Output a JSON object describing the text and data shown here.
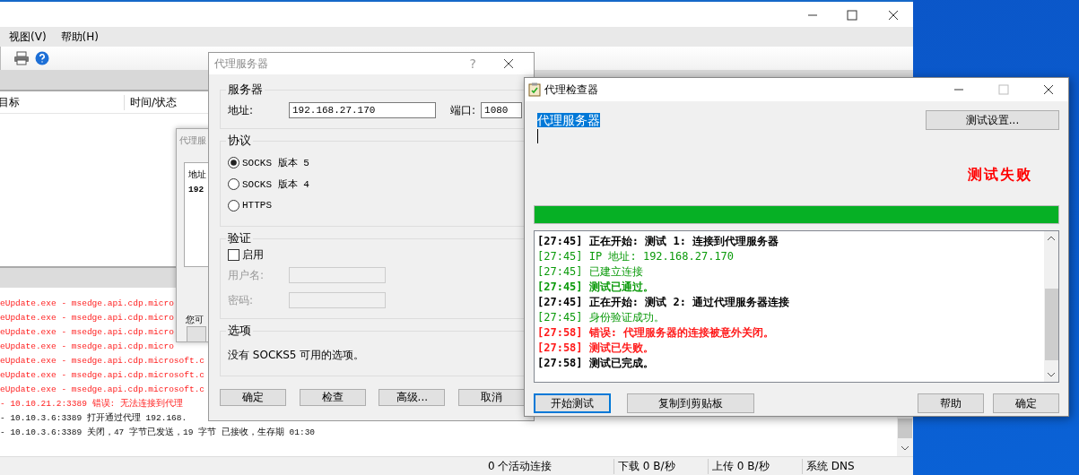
{
  "main_window": {
    "menu": [
      "视图(V)",
      "帮助(H)"
    ],
    "columns": [
      "目标",
      "时间/状态"
    ],
    "log": [
      {
        "text": "eUpdate.exe - msedge.api.cdp.micro",
        "kind": "error"
      },
      {
        "text": "eUpdate.exe - msedge.api.cdp.micro",
        "kind": "error"
      },
      {
        "text": "eUpdate.exe - msedge.api.cdp.micro",
        "kind": "error"
      },
      {
        "text": "eUpdate.exe - msedge.api.cdp.micro",
        "kind": "error"
      },
      {
        "text": "eUpdate.exe - msedge.api.cdp.microsoft.c",
        "kind": "error"
      },
      {
        "text": "eUpdate.exe - msedge.api.cdp.microsoft.c",
        "kind": "error"
      },
      {
        "text": "eUpdate.exe - msedge.api.cdp.microsoft.c",
        "kind": "error"
      },
      {
        "text": "- 10.10.21.2:3389 错误: 无法连接到代理",
        "kind": "error"
      },
      {
        "text": "- 10.10.3.6:3389 打开通过代理 192.168.",
        "kind": "info"
      },
      {
        "text": "- 10.10.3.6:3389 关闭，47 字节已发送，19 字节 已接收，生存期 01:30",
        "kind": "info"
      }
    ],
    "status_bar": [
      "0 个活动连接",
      "下载 0 B/秒",
      "上传 0 B/秒",
      "系统 DNS"
    ]
  },
  "background_dialog": {
    "title": "代理服",
    "label": "地址",
    "value": "192",
    "note": "您可"
  },
  "proxy_dialog": {
    "title": "代理服务器",
    "help": "?",
    "server_group": "服务器",
    "address_label": "地址:",
    "address": "192.168.27.170",
    "port_label": "端口:",
    "port": "1080",
    "protocol_group": "协议",
    "protocols": [
      {
        "label": "SOCKS 版本 5",
        "selected": true
      },
      {
        "label": "SOCKS 版本 4",
        "selected": false
      },
      {
        "label": "HTTPS",
        "selected": false
      }
    ],
    "auth_group": "验证",
    "auth_enabled": {
      "label": "启用",
      "checked": false
    },
    "username_label": "用户名:",
    "password_label": "密码:",
    "options_group": "选项",
    "options_text": "没有 SOCKS5 可用的选项。",
    "buttons": [
      "确定",
      "检查",
      "高级...",
      "取消"
    ]
  },
  "checker": {
    "title": "代理检查器",
    "selected_text": "代理服务器",
    "settings_button": "测试设置...",
    "result": "测试失败",
    "progress": {
      "level": 1
    },
    "log": [
      {
        "text": "[27:45] 正在开始: 测试 1: 连接到代理服务器",
        "kind": "step"
      },
      {
        "text": "[27:45] IP 地址: 192.168.27.170",
        "kind": "info"
      },
      {
        "text": "[27:45] 已建立连接",
        "kind": "info"
      },
      {
        "text": "[27:45] 测试已通过。",
        "kind": "success"
      },
      {
        "text": "[27:45] 正在开始: 测试 2: 通过代理服务器连接",
        "kind": "step"
      },
      {
        "text": "[27:45] 身份验证成功。",
        "kind": "info"
      },
      {
        "text": "[27:58] 错误: 代理服务器的连接被意外关闭。",
        "kind": "error"
      },
      {
        "text": "[27:58] 测试已失败。",
        "kind": "error"
      },
      {
        "text": "[27:58] 测试已完成。",
        "kind": "step"
      }
    ],
    "buttons": [
      {
        "label": "开始测试",
        "focused": true
      },
      {
        "label": "复制到剪贴板",
        "focused": false
      },
      {
        "label": "帮助",
        "focused": false
      },
      {
        "label": "确定",
        "focused": false
      }
    ]
  }
}
